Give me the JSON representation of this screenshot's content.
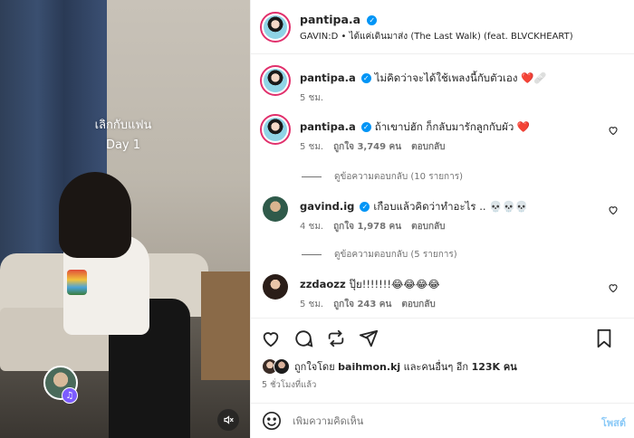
{
  "media": {
    "caption_line1": "เลิกกับแฟน",
    "caption_line2": "Day 1"
  },
  "header": {
    "username": "pantipa.a",
    "song": "GAVIN:D • ได้แค่เดินมาส่ง (The Last Walk) (feat. BLVCKHEART)"
  },
  "comments": [
    {
      "username": "pantipa.a",
      "text": "ไม่คิดว่าจะได้ใช้เพลงนี้กับตัวเอง ❤️🩹",
      "time": "5 ชม."
    },
    {
      "username": "pantipa.a",
      "text": "ถ้าเขาบ่ฮัก ก็กลับมารักลูกกับผัว ❤️",
      "time": "5 ชม.",
      "likes": "ถูกใจ 3,749 คน",
      "reply": "ตอบกลับ",
      "view_replies": "ดูข้อความตอบกลับ (10 รายการ)"
    },
    {
      "username": "gavind.ig",
      "text": "เกือบแล้วคิดว่าทำอะไร .. 💀💀💀",
      "time": "4 ชม.",
      "likes": "ถูกใจ 1,978 คน",
      "reply": "ตอบกลับ",
      "view_replies": "ดูข้อความตอบกลับ (5 รายการ)"
    },
    {
      "username": "zzdaozz",
      "text": "ปุ๊ย!!!!!!!😂😂😂😂",
      "time": "5 ชม.",
      "likes": "ถูกใจ 243 คน",
      "reply": "ตอบกลับ"
    }
  ],
  "likes_summary": {
    "prefix": "ถูกใจโดย",
    "user": "baihmon.kj",
    "middle": "และคนอื่นๆ อีก",
    "count": "123K คน"
  },
  "post_time": "5 ชั่วโมงที่แล้ว",
  "composer": {
    "placeholder": "เพิ่มความคิดเห็น",
    "post_label": "โพสต์"
  },
  "icons": {
    "like": "heart-icon",
    "comment": "comment-icon",
    "repost": "repost-icon",
    "share": "share-icon",
    "save": "bookmark-icon",
    "emoji": "emoji-icon",
    "mute": "mute-icon",
    "music": "music-icon"
  },
  "colors": {
    "verified": "#0095f6",
    "heart": "#e0245e",
    "post_button": "#8ccaf7"
  }
}
